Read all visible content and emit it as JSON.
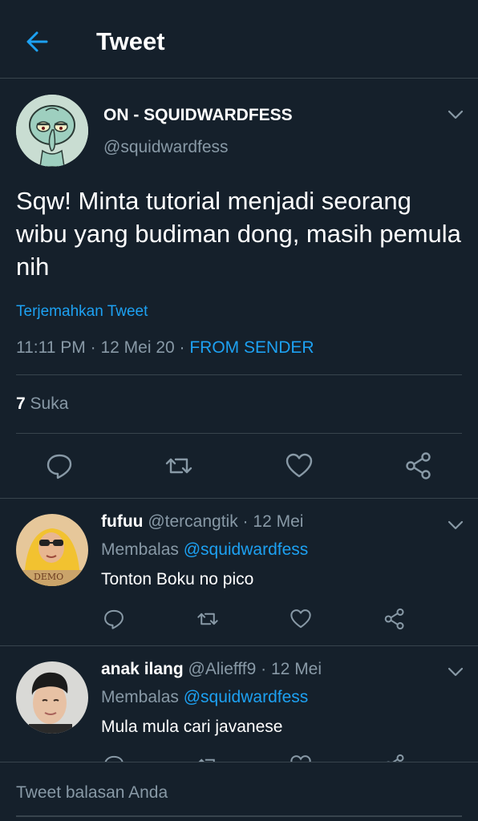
{
  "header": {
    "title": "Tweet",
    "back_icon": "arrow-left-icon"
  },
  "tweet": {
    "author_name": "ON - SQUIDWARDFESS",
    "author_handle": "@squidwardfess",
    "text": "Sqw! Minta tutorial menjadi seorang wibu yang budiman dong, masih pemula nih",
    "translate_label": "Terjemahkan Tweet",
    "time": "11:11 PM",
    "date": "12 Mei 20",
    "source": "FROM SENDER",
    "likes_count": "7",
    "likes_label": "Suka"
  },
  "replies": [
    {
      "name": "fufuu",
      "handle": "@tercangtik",
      "date": "12 Mei",
      "replying_label": "Membalas",
      "replying_to": "@squidwardfess",
      "text": "Tonton Boku no pico"
    },
    {
      "name": "anak ilang",
      "handle": "@Aliefff9",
      "date": "12 Mei",
      "replying_label": "Membalas",
      "replying_to": "@squidwardfess",
      "text": "Mula mula cari javanese"
    }
  ],
  "compose": {
    "placeholder": "Tweet balasan Anda"
  },
  "colors": {
    "background": "#15202b",
    "accent": "#1da1f2",
    "muted": "#8899a6",
    "divider": "#38444d"
  }
}
